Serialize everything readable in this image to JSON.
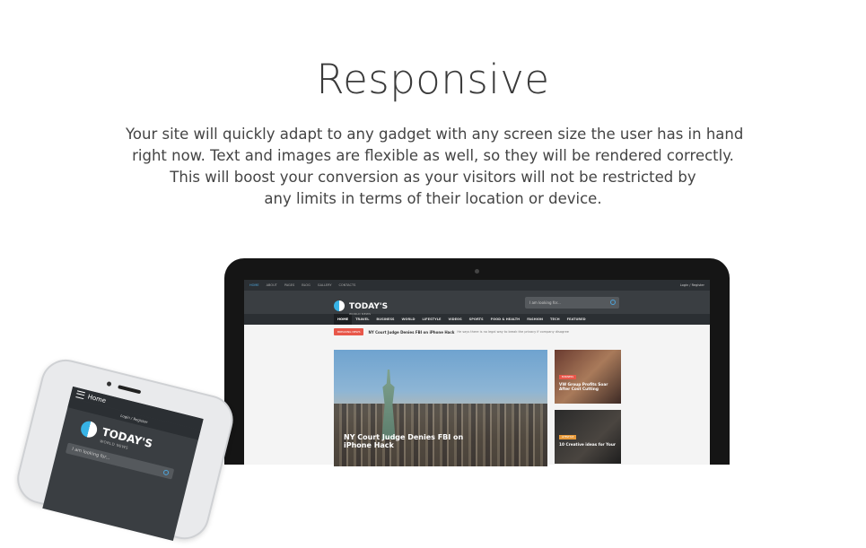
{
  "hero": {
    "title": "Responsive",
    "description_lines": [
      "Your site will quickly adapt to any gadget with any screen size the user has in hand",
      "right now. Text and images are flexible as well, so they will be rendered correctly.",
      "This will boost your conversion as your visitors will not be restricted by",
      "any limits in terms of their location or device."
    ]
  },
  "laptop_site": {
    "top_links": [
      "HOME",
      "ABOUT",
      "PAGES",
      "BLOG",
      "GALLERY",
      "CONTACTS"
    ],
    "login": "Login / Register",
    "logo_title": "TODAY'S",
    "logo_sub": "WORLD NEWS",
    "search_placeholder": "I am looking for...",
    "nav": [
      "HOME",
      "TRAVEL",
      "BUSINESS",
      "WORLD",
      "LIFESTYLE",
      "VIDEOS",
      "SPORTS",
      "FOOD & HEALTH",
      "FASHION",
      "TECH",
      "FEATURED"
    ],
    "breaking_badge": "BREAKING NEWS",
    "breaking_headline": "NY Court Judge Denies FBI on iPhone Hack",
    "breaking_desc": "He says there is no legal way to break the privacy if company disagree",
    "feature_title": "NY Court Judge Denies FBI on iPhone Hack",
    "side_items": [
      {
        "badge": "BUSINESS",
        "title": "VW Group Profits Soar After Cost Cutting"
      },
      {
        "badge": "LIFESTYLE",
        "title": "10 Creative ideas for Your"
      }
    ]
  },
  "phone_site": {
    "home_label": "Home",
    "login": "Login / Register",
    "logo_title": "TODAY'S",
    "logo_sub": "WORLD NEWS",
    "search_placeholder": "I am looking for..."
  }
}
